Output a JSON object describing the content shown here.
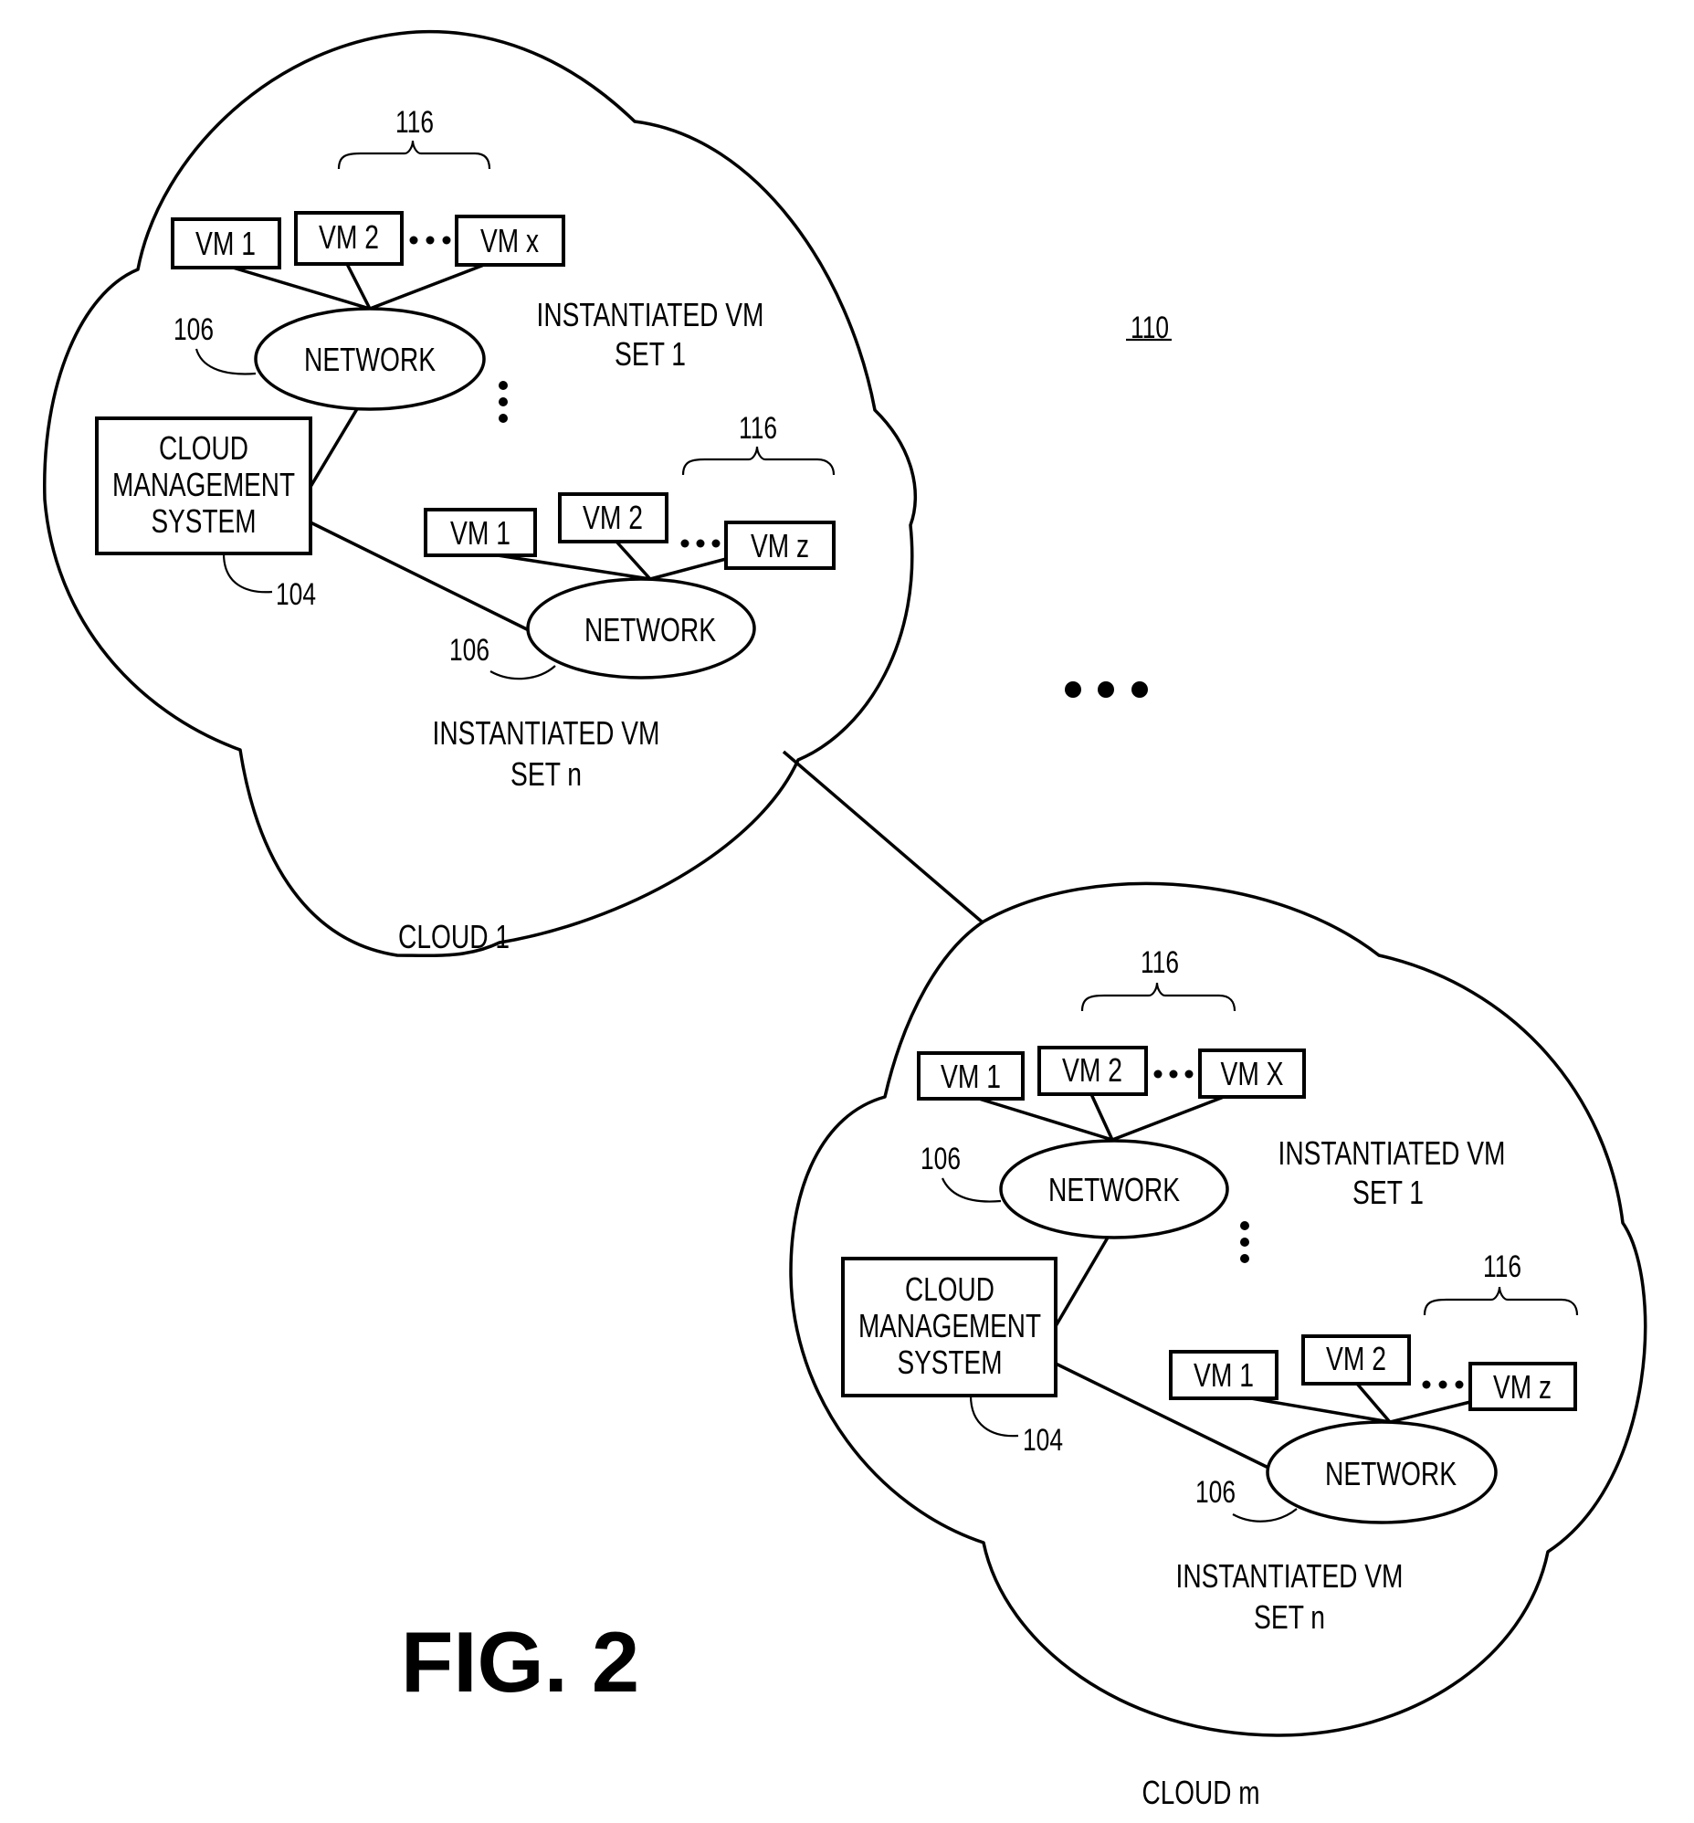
{
  "figure": {
    "title": "FIG. 2",
    "system_ref": "110",
    "between_clouds_ellipsis": "…"
  },
  "clouds": [
    {
      "name": "CLOUD 1",
      "cms": {
        "lines": [
          "CLOUD",
          "MANAGEMENT",
          "SYSTEM"
        ],
        "ref": "104"
      },
      "vm_sets": [
        {
          "label_line1": "INSTANTIATED VM",
          "label_line2": "SET 1",
          "group_ref": "116",
          "network": {
            "label": "NETWORK",
            "ref": "106"
          },
          "vms": [
            "VM 1",
            "VM 2",
            "VM x"
          ]
        },
        {
          "label_line1": "INSTANTIATED VM",
          "label_line2": "SET n",
          "group_ref": "116",
          "network": {
            "label": "NETWORK",
            "ref": "106"
          },
          "vms": [
            "VM 1",
            "VM 2",
            "VM z"
          ]
        }
      ]
    },
    {
      "name": "CLOUD m",
      "cms": {
        "lines": [
          "CLOUD",
          "MANAGEMENT",
          "SYSTEM"
        ],
        "ref": "104"
      },
      "vm_sets": [
        {
          "label_line1": "INSTANTIATED VM",
          "label_line2": "SET 1",
          "group_ref": "116",
          "network": {
            "label": "NETWORK",
            "ref": "106"
          },
          "vms": [
            "VM 1",
            "VM 2",
            "VM X"
          ]
        },
        {
          "label_line1": "INSTANTIATED VM",
          "label_line2": "SET n",
          "group_ref": "116",
          "network": {
            "label": "NETWORK",
            "ref": "106"
          },
          "vms": [
            "VM 1",
            "VM 2",
            "VM z"
          ]
        }
      ]
    }
  ]
}
